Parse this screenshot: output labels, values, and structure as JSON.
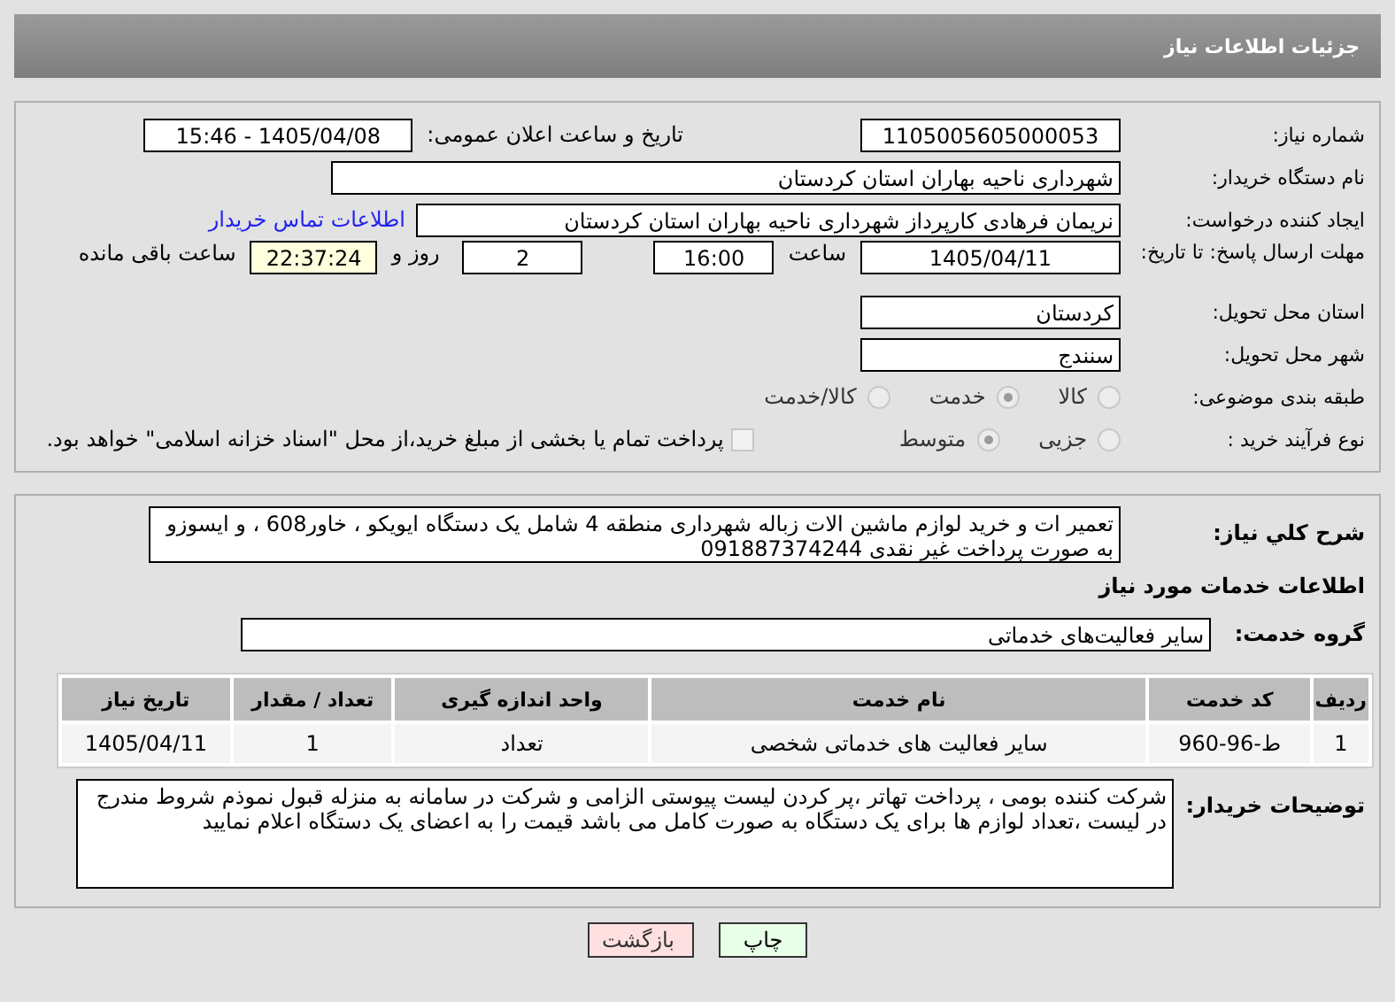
{
  "header": {
    "title": "جزئیات اطلاعات نیاز"
  },
  "need_number": {
    "label": "شماره نیاز:",
    "value": "1105005605000053"
  },
  "announce": {
    "label": "تاریخ و ساعت اعلان عمومی:",
    "value": "1405/04/08 - 15:46"
  },
  "buyer_org": {
    "label": "نام دستگاه خریدار:",
    "value": "شهرداری ناحیه بهاران استان کردستان"
  },
  "requester": {
    "label": "ایجاد کننده درخواست:",
    "value": "نریمان فرهادی کارپرداز شهرداری ناحیه بهاران استان کردستان",
    "link": "اطلاعات تماس خریدار"
  },
  "deadline": {
    "label": "مهلت ارسال پاسخ: تا تاریخ:",
    "date": "1405/04/11",
    "time_label": "ساعت",
    "time": "16:00",
    "days": "2",
    "days_label": "روز و",
    "remaining": "22:37:24",
    "remaining_label": "ساعت باقی مانده"
  },
  "province": {
    "label": "استان محل تحویل:",
    "value": "کردستان"
  },
  "city": {
    "label": "شهر محل تحویل:",
    "value": "سنندج"
  },
  "category": {
    "label": "طبقه بندی موضوعی:",
    "options": [
      {
        "label": "کالا",
        "selected": false
      },
      {
        "label": "خدمت",
        "selected": true
      },
      {
        "label": "کالا/خدمت",
        "selected": false
      }
    ]
  },
  "purchase_type": {
    "label": "نوع فرآیند خرید :",
    "options": [
      {
        "label": "جزیی",
        "selected": false
      },
      {
        "label": "متوسط",
        "selected": true
      }
    ],
    "payment": {
      "checked": false,
      "label": "پرداخت تمام یا بخشی از مبلغ خرید،از محل \"اسناد خزانه اسلامی\" خواهد بود."
    }
  },
  "description": {
    "label": "شرح کلي نياز:",
    "value": "تعمیر ات و خرید لوازم  ماشین الات زباله شهرداری منطقه 4 شامل یک دستگاه ایویکو ، خاور608 ، و ایسوزو به صورت پرداخت غیر نقدی 091887374244"
  },
  "services_title": "اطلاعات خدمات مورد نیاز",
  "service_group": {
    "label": "گروه خدمت:",
    "value": "سایر فعالیت‌های خدماتی"
  },
  "table": {
    "columns": [
      "ردیف",
      "کد خدمت",
      "نام خدمت",
      "واحد اندازه گیری",
      "تعداد / مقدار",
      "تاریخ نیاز"
    ],
    "rows": [
      [
        "1",
        "ط-96-960",
        "سایر فعالیت های خدماتی شخصی",
        "تعداد",
        "1",
        "1405/04/11"
      ]
    ]
  },
  "buyer_notes": {
    "label": "توضیحات خریدار:",
    "value": "شرکت کننده بومی ، پرداخت تهاتر ،پر کردن لیست پیوستی الزامی و شرکت در سامانه به منزله قبول نموذم شروط مندرج در لیست ،تعداد  لوازم ها برای یک دستگاه به صورت کامل می باشد قیمت را به اعضای یک دستگاه اعلام نمایید"
  },
  "buttons": [
    {
      "kind": "print",
      "label": "چاپ"
    },
    {
      "kind": "back",
      "label": "بازگشت"
    }
  ]
}
